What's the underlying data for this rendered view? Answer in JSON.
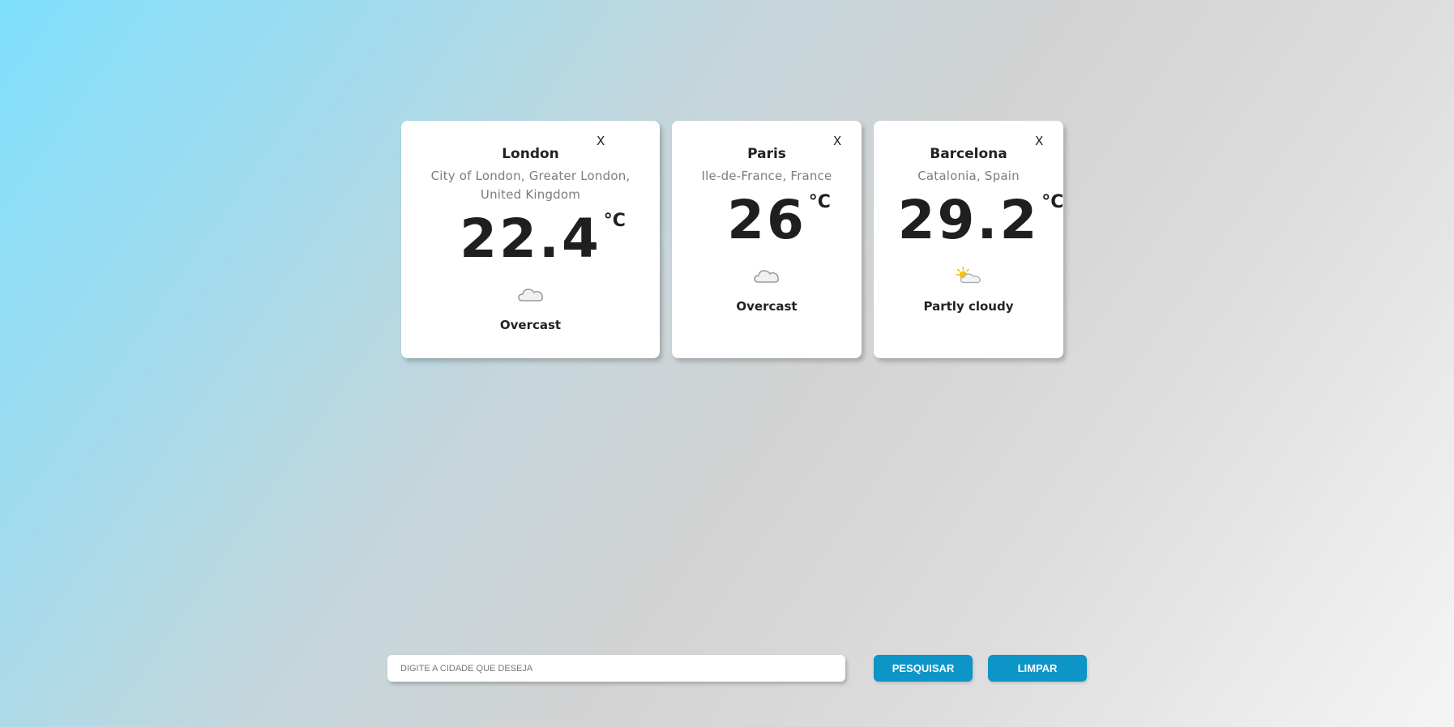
{
  "cards": [
    {
      "city": "London",
      "region": "City of London, Greater London, United Kingdom",
      "temperature": "22.4",
      "unit": "°C",
      "condition": "Overcast",
      "icon": "cloud-icon",
      "close_label": "X"
    },
    {
      "city": "Paris",
      "region": "Ile-de-France, France",
      "temperature": "26",
      "unit": "°C",
      "condition": "Overcast",
      "icon": "cloud-icon",
      "close_label": "X"
    },
    {
      "city": "Barcelona",
      "region": "Catalonia, Spain",
      "temperature": "29.2",
      "unit": "°C",
      "condition": "Partly cloudy",
      "icon": "partly-cloudy-icon",
      "close_label": "X"
    }
  ],
  "search": {
    "placeholder": "DIGITE A CIDADE QUE DESEJA",
    "value": "",
    "search_label": "PESQUISAR",
    "clear_label": "LIMPAR"
  },
  "colors": {
    "button": "#0e95c8",
    "gradient_start": "#7fdffd",
    "gradient_mid": "#d3d3d3",
    "gradient_end": "#f5f5f5"
  }
}
